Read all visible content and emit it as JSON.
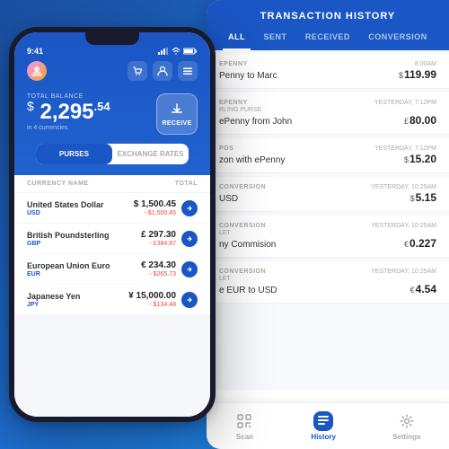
{
  "app": {
    "title": "Transaction History"
  },
  "history_panel": {
    "title": "TRANSACTION HISTORY",
    "tabs": [
      {
        "id": "all",
        "label": "ALL",
        "active": true
      },
      {
        "id": "sent",
        "label": "SENT",
        "active": false
      },
      {
        "id": "received",
        "label": "RECEIVED",
        "active": false
      },
      {
        "id": "conversion",
        "label": "CONVERSION",
        "active": false
      }
    ],
    "items": [
      {
        "category": "ePENNY",
        "time": "8:00AM",
        "description": "Penny to Marc",
        "currency_symbol": "$",
        "amount": "119.99"
      },
      {
        "category": "ePENNY",
        "time": "YESTERDAY, 7:12PM",
        "description": "RLING PURSE\nePenny from John",
        "currency_symbol": "£",
        "amount": "80.00"
      },
      {
        "category": "POS",
        "time": "YESTERDAY, 7:12PM",
        "description": "zon with ePenny",
        "currency_symbol": "$",
        "amount": "15.20"
      },
      {
        "category": "CONVERSION",
        "time": "YESTERDAY, 10:25AM",
        "description": "USD",
        "currency_symbol": "$",
        "amount": "5.15"
      },
      {
        "category": "CONVERSION",
        "time": "YESTERDAY, 10:25AM",
        "description": "LET\nny Commision",
        "currency_symbol": "€",
        "amount": "0.227"
      },
      {
        "category": "CONVERSION",
        "time": "YESTERDAY, 10:25AM",
        "description": "e EUR to USD",
        "currency_symbol": "€",
        "amount": "4.54"
      }
    ],
    "bottom_nav": [
      {
        "id": "scan",
        "label": "Scan",
        "active": false
      },
      {
        "id": "history",
        "label": "History",
        "active": true
      },
      {
        "id": "settings",
        "label": "Settings",
        "active": false
      }
    ]
  },
  "phone": {
    "status": {
      "time": "9:41"
    },
    "balance": {
      "label": "TOTAL BALANCE",
      "symbol": "$",
      "main": "2,295",
      "cents": ".54",
      "sub": "in 4 currencies"
    },
    "receive_btn": "RECEIVE",
    "tabs": [
      {
        "label": "PURSES",
        "active": true
      },
      {
        "label": "EXCHANGE RATES",
        "active": false
      }
    ],
    "purse_header": {
      "currency_name": "CURRENCY NAME",
      "total": "TOTAL"
    },
    "purses": [
      {
        "name": "United States Dollar",
        "code": "USD",
        "amount": "$ 1,500.45",
        "change": "- $1,500.45"
      },
      {
        "name": "British Poundsterling",
        "code": "GBP",
        "amount": "£ 297.30",
        "change": "- £384.87"
      },
      {
        "name": "European Union Euro",
        "code": "EUR",
        "amount": "€ 234.30",
        "change": "- $265.73"
      },
      {
        "name": "Japanese Yen",
        "code": "JPY",
        "amount": "¥ 15,000.00",
        "change": "- $134.48"
      }
    ]
  }
}
